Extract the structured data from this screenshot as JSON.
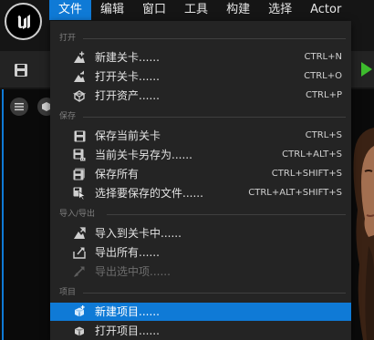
{
  "menubar": {
    "items": [
      "文件",
      "编辑",
      "窗口",
      "工具",
      "构建",
      "选择",
      "Actor"
    ]
  },
  "file_menu": {
    "sections": [
      {
        "title": "打开",
        "items": [
          {
            "label": "新建关卡......",
            "shortcut": "CTRL+N",
            "icon": "new-level-icon"
          },
          {
            "label": "打开关卡......",
            "shortcut": "CTRL+O",
            "icon": "open-level-icon"
          },
          {
            "label": "打开资产......",
            "shortcut": "CTRL+P",
            "icon": "open-asset-icon"
          }
        ]
      },
      {
        "title": "保存",
        "items": [
          {
            "label": "保存当前关卡",
            "shortcut": "CTRL+S",
            "icon": "save-icon"
          },
          {
            "label": "当前关卡另存为......",
            "shortcut": "CTRL+ALT+S",
            "icon": "save-as-icon"
          },
          {
            "label": "保存所有",
            "shortcut": "CTRL+SHIFT+S",
            "icon": "save-all-icon"
          },
          {
            "label": "选择要保存的文件......",
            "shortcut": "CTRL+ALT+SHIFT+S",
            "icon": "choose-files-icon"
          }
        ]
      },
      {
        "title": "导入/导出",
        "items": [
          {
            "label": "导入到关卡中......",
            "shortcut": "",
            "icon": "import-icon"
          },
          {
            "label": "导出所有......",
            "shortcut": "",
            "icon": "export-icon"
          },
          {
            "label": "导出选中项......",
            "shortcut": "",
            "icon": "export-selected-icon",
            "disabled": true
          }
        ]
      },
      {
        "title": "项目",
        "items": [
          {
            "label": "新建项目......",
            "shortcut": "",
            "icon": "new-project-icon",
            "highlighted": true
          },
          {
            "label": "打开项目......",
            "shortcut": "",
            "icon": "open-project-icon"
          }
        ]
      }
    ]
  },
  "colors": {
    "accent": "#0f7ad6",
    "menu_bg": "#242424",
    "play": "#3dbb2d"
  }
}
